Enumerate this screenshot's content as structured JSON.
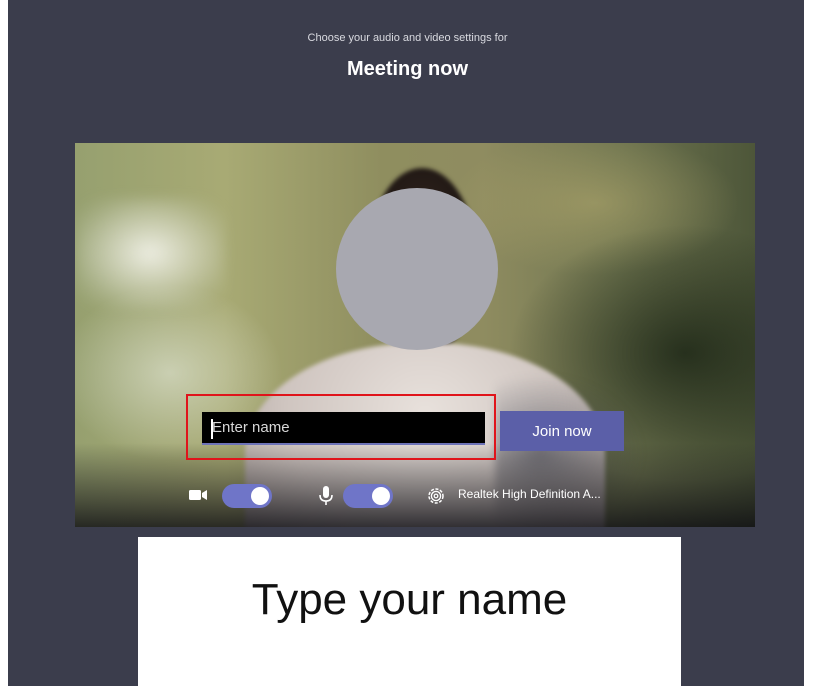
{
  "header": {
    "subtitle": "Choose your audio and video settings for",
    "title": "Meeting now"
  },
  "join_form": {
    "name_placeholder": "Enter name",
    "name_value": "",
    "join_label": "Join now"
  },
  "controls": {
    "camera_on": true,
    "mic_on": true,
    "audio_device": "Realtek High Definition A..."
  },
  "caption": {
    "text": "Type your name"
  },
  "colors": {
    "background": "#3b3d4c",
    "accent": "#6f75c8",
    "join_button": "#5b5fa8",
    "highlight": "#e0141b",
    "face_cover": "#a8a8b0"
  },
  "icons": [
    "camera-icon",
    "microphone-icon",
    "gear-icon"
  ]
}
